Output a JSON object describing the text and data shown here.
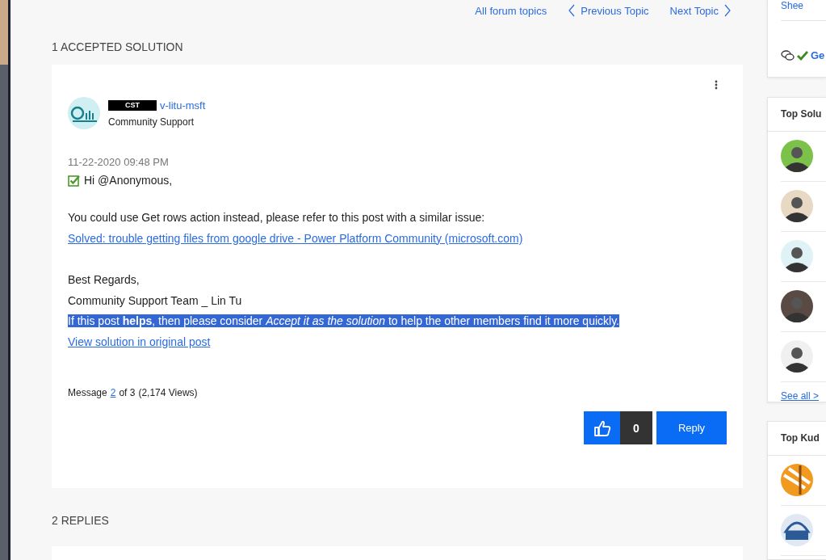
{
  "nav": {
    "all_topics": "All forum topics",
    "previous": "Previous Topic",
    "next": "Next Topic"
  },
  "accepted_heading": "1 ACCEPTED SOLUTION",
  "post": {
    "badge": "CST",
    "author": "v-litu-msft",
    "rank": "Community Support",
    "date": "11-22-2020 09:48 PM",
    "greeting": "Hi @Anonymous,",
    "paragraphs": [
      [
        {
          "kind": "text",
          "text": "You could use Get rows action instead, please refer to this post with a similar issue:",
          "highlighted": false
        },
        {
          "kind": "link",
          "text": "Solved: trouble getting files from google drive - Power Platform Community (microsoft.com)",
          "highlighted": false
        }
      ],
      [
        {
          "kind": "text",
          "text": "Best Regards,",
          "highlighted": false
        },
        {
          "kind": "text",
          "text": "Community Support Team _ Lin Tu",
          "highlighted": false
        },
        {
          "kind": "text",
          "text": "If this post **helps**, then please consider *Accept it as the solution* to help the other members find it more quickly.",
          "highlighted": true
        },
        {
          "kind": "link",
          "text": "View solution in original post",
          "highlighted": false
        }
      ]
    ],
    "message": {
      "label": "Message",
      "number": "2",
      "of": "of 3",
      "views": "(2,174 Views)"
    },
    "kudos_count": "0",
    "reply": "Reply"
  },
  "replies_heading": "2 REPLIES",
  "sidebar": {
    "top_link": "Shee",
    "action_link": "Ge",
    "top_solutions": {
      "title": "Top Solu",
      "see_all": "See all >"
    },
    "top_kudos": {
      "title": "Top Kud"
    }
  }
}
